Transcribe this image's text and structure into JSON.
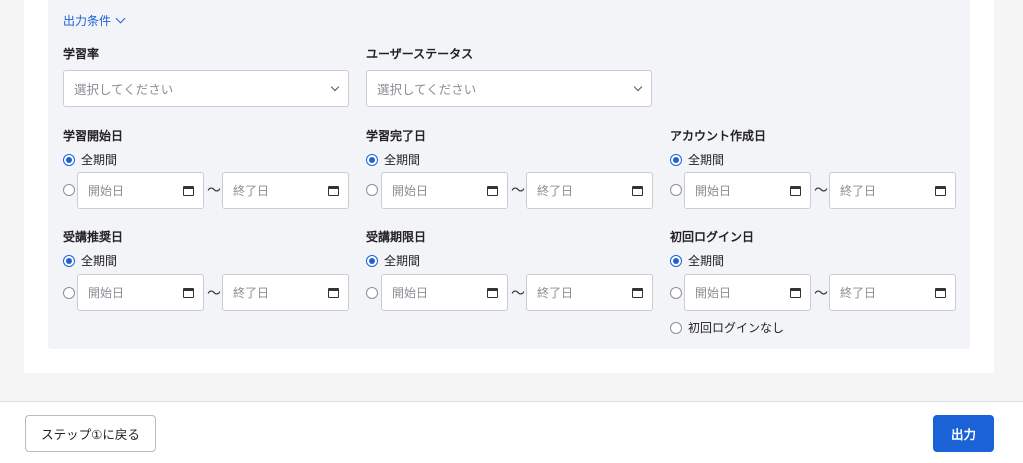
{
  "conditions": {
    "toggle_label": "出力条件",
    "learning_rate": {
      "label": "学習率",
      "placeholder": "選択してください"
    },
    "user_status": {
      "label": "ユーザーステータス",
      "placeholder": "選択してください"
    },
    "all_period_label": "全期間",
    "start_placeholder": "開始日",
    "end_placeholder": "終了日",
    "tilde": "～",
    "date_filters": [
      {
        "label": "学習開始日"
      },
      {
        "label": "学習完了日"
      },
      {
        "label": "アカウント作成日"
      },
      {
        "label": "受講推奨日"
      },
      {
        "label": "受講期限日"
      },
      {
        "label": "初回ログイン日"
      }
    ],
    "no_login_label": "初回ログインなし"
  },
  "footer": {
    "back_label": "ステップ①に戻る",
    "output_label": "出力"
  },
  "colors": {
    "accent": "#1a62d6",
    "panel": "#f3f4f8"
  }
}
